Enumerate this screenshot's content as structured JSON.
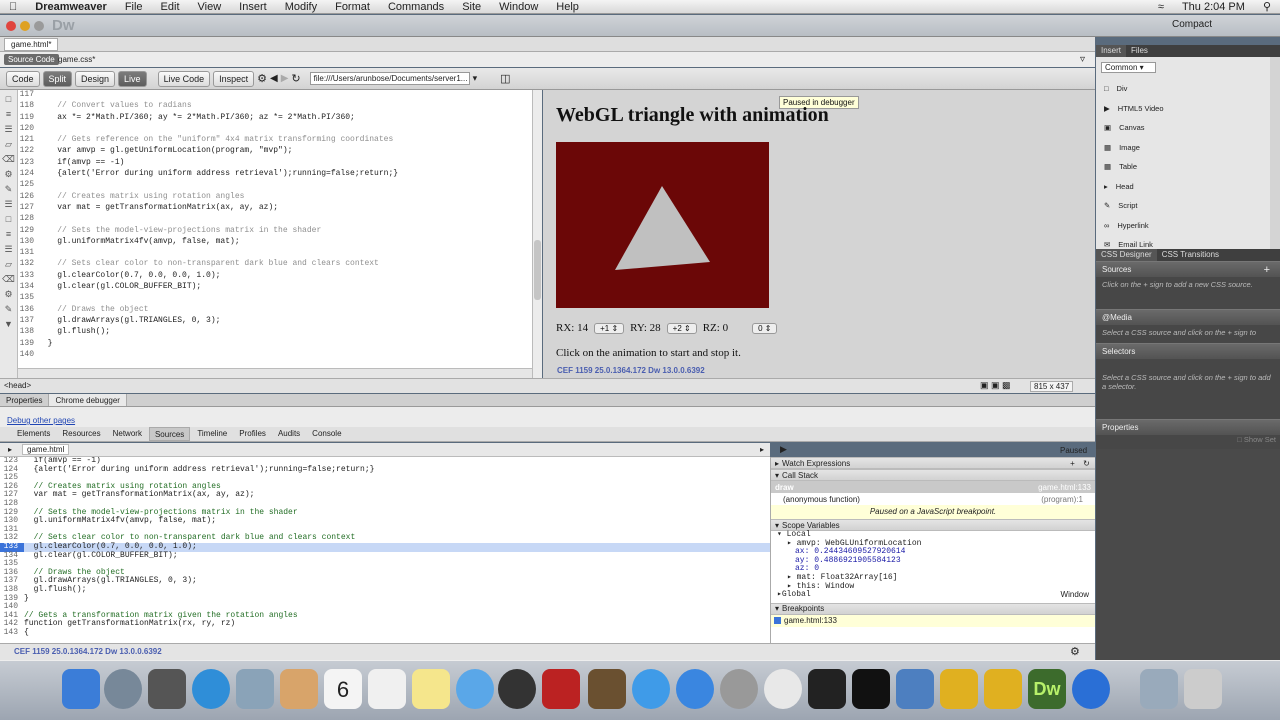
{
  "menubar": {
    "app": "Dreamweaver",
    "items": [
      "File",
      "Edit",
      "View",
      "Insert",
      "Modify",
      "Format",
      "Commands",
      "Site",
      "Window",
      "Help"
    ],
    "clock": "Thu 2:04 PM"
  },
  "titlebar": {
    "logo": "Dw",
    "layout": "Compact"
  },
  "doc_tabs": {
    "file": "game.html*",
    "related": [
      "Source Code",
      "game.css*"
    ]
  },
  "view_buttons": {
    "code": "Code",
    "split": "Split",
    "design": "Design",
    "live": "Live",
    "live_code": "Live Code",
    "inspect": "Inspect",
    "address": "file:///Users/arunbose/Documents/server1..."
  },
  "code_lines": [
    {
      "n": "117",
      "t": ""
    },
    {
      "n": "118",
      "t": "    // Convert values to radians",
      "c": true
    },
    {
      "n": "119",
      "t": "    ax *= 2*Math.PI/360; ay *= 2*Math.PI/360; az *= 2*Math.PI/360;"
    },
    {
      "n": "120",
      "t": ""
    },
    {
      "n": "121",
      "t": "    // Gets reference on the \"uniform\" 4x4 matrix transforming coordinates",
      "c": true
    },
    {
      "n": "122",
      "t": "    var amvp = gl.getUniformLocation(program, \"mvp\");"
    },
    {
      "n": "123",
      "t": "    if(amvp == -1)"
    },
    {
      "n": "124",
      "t": "    {alert('Error during uniform address retrieval');running=false;return;}"
    },
    {
      "n": "125",
      "t": ""
    },
    {
      "n": "126",
      "t": "    // Creates matrix using rotation angles",
      "c": true
    },
    {
      "n": "127",
      "t": "    var mat = getTransformationMatrix(ax, ay, az);"
    },
    {
      "n": "128",
      "t": ""
    },
    {
      "n": "129",
      "t": "    // Sets the model-view-projections matrix in the shader",
      "c": true
    },
    {
      "n": "130",
      "t": "    gl.uniformMatrix4fv(amvp, false, mat);"
    },
    {
      "n": "131",
      "t": ""
    },
    {
      "n": "132",
      "t": "    // Sets clear color to non-transparent dark blue and clears context",
      "c": true
    },
    {
      "n": "133",
      "t": "    gl.clearColor(0.7, 0.0, 0.0, 1.0);"
    },
    {
      "n": "134",
      "t": "    gl.clear(gl.COLOR_BUFFER_BIT);"
    },
    {
      "n": "135",
      "t": ""
    },
    {
      "n": "136",
      "t": "    // Draws the object",
      "c": true
    },
    {
      "n": "137",
      "t": "    gl.drawArrays(gl.TRIANGLES, 0, 3);"
    },
    {
      "n": "138",
      "t": "    gl.flush();"
    },
    {
      "n": "139",
      "t": "  }"
    },
    {
      "n": "140",
      "t": ""
    }
  ],
  "live_view": {
    "paused": "Paused in debugger",
    "heading": "WebGL triangle with animation",
    "rx": "RX: 14",
    "ry": "RY: 28",
    "rz": "RZ: 0",
    "rx_sel": "+1",
    "ry_sel": "+2",
    "rz_sel": "0",
    "hint": "Click on the animation to start and stop it.",
    "cef": "CEF 1159 25.0.1364.172 Dw 13.0.0.6392",
    "canvas_color": "#6b0707"
  },
  "status_row": {
    "tag": "<head>",
    "size": "815 x 437"
  },
  "bottom_tabs": [
    "Properties",
    "Chrome debugger"
  ],
  "devtools": {
    "debug_link": "Debug other pages",
    "tabs": [
      "Elements",
      "Resources",
      "Network",
      "Sources",
      "Timeline",
      "Profiles",
      "Audits",
      "Console"
    ],
    "active_tab": "Sources",
    "file": "game.html",
    "paused": "Paused"
  },
  "src_lines": [
    {
      "n": "123",
      "t": "  if(amvp == -1)"
    },
    {
      "n": "124",
      "t": "  {alert('Error during uniform address retrieval');running=false;return;}"
    },
    {
      "n": "125",
      "t": ""
    },
    {
      "n": "126",
      "t": "  // Creates matrix using rotation angles"
    },
    {
      "n": "127",
      "t": "  var mat = getTransformationMatrix(ax, ay, az);"
    },
    {
      "n": "128",
      "t": ""
    },
    {
      "n": "129",
      "t": "  // Sets the model-view-projections matrix in the shader"
    },
    {
      "n": "130",
      "t": "  gl.uniformMatrix4fv(amvp, false, mat);"
    },
    {
      "n": "131",
      "t": ""
    },
    {
      "n": "132",
      "t": "  // Sets clear color to non-transparent dark blue and clears context"
    },
    {
      "n": "133",
      "t": "  gl.clearColor(0.7, 0.0, 0.0, 1.0);",
      "hl": true
    },
    {
      "n": "134",
      "t": "  gl.clear(gl.COLOR_BUFFER_BIT);"
    },
    {
      "n": "135",
      "t": ""
    },
    {
      "n": "136",
      "t": "  // Draws the object"
    },
    {
      "n": "137",
      "t": "  gl.drawArrays(gl.TRIANGLES, 0, 3);"
    },
    {
      "n": "138",
      "t": "  gl.flush();"
    },
    {
      "n": "139",
      "t": "}"
    },
    {
      "n": "140",
      "t": ""
    },
    {
      "n": "141",
      "t": "// Gets a transformation matrix given the rotation angles"
    },
    {
      "n": "142",
      "t": "function getTransformationMatrix(rx, ry, rz)"
    },
    {
      "n": "143",
      "t": "{"
    }
  ],
  "debug_panel": {
    "watch": "Watch Expressions",
    "call_stack": "Call Stack",
    "frames": [
      {
        "name": "draw",
        "loc": "game.html:133"
      },
      {
        "name": "(anonymous function)",
        "loc": "(program):1"
      }
    ],
    "paused_msg": "Paused on a JavaScript breakpoint.",
    "scope": "Scope Variables",
    "local": "Local",
    "vars": [
      "amvp: WebGLUniformLocation",
      "ax: 0.24434609527920614",
      "ay: 0.4886921905584123",
      "az: 0",
      "mat: Float32Array[16]",
      "this: Window"
    ],
    "global": "Global",
    "global_val": "Window",
    "breakpoints": "Breakpoints",
    "bp": "game.html:133"
  },
  "devtools_status": "CEF 1159 25.0.1364.172 Dw 13.0.0.6392",
  "side": {
    "tabs": [
      "Insert",
      "Files"
    ],
    "category": "Common",
    "items": [
      "Div",
      "HTML5 Video",
      "Canvas",
      "Image",
      "Table",
      "Head",
      "Script",
      "Hyperlink",
      "Email Link"
    ],
    "css_tabs": [
      "CSS Designer",
      "CSS Transitions"
    ],
    "sources": "Sources",
    "sources_hint": "Click on the + sign to add a new CSS source.",
    "media": "@Media",
    "media_hint": "Select a CSS source and click on the + sign to",
    "selectors": "Selectors",
    "selectors_hint": "Select a CSS source and click on the + sign to add a selector.",
    "properties": "Properties",
    "show_set": "Show Set"
  }
}
